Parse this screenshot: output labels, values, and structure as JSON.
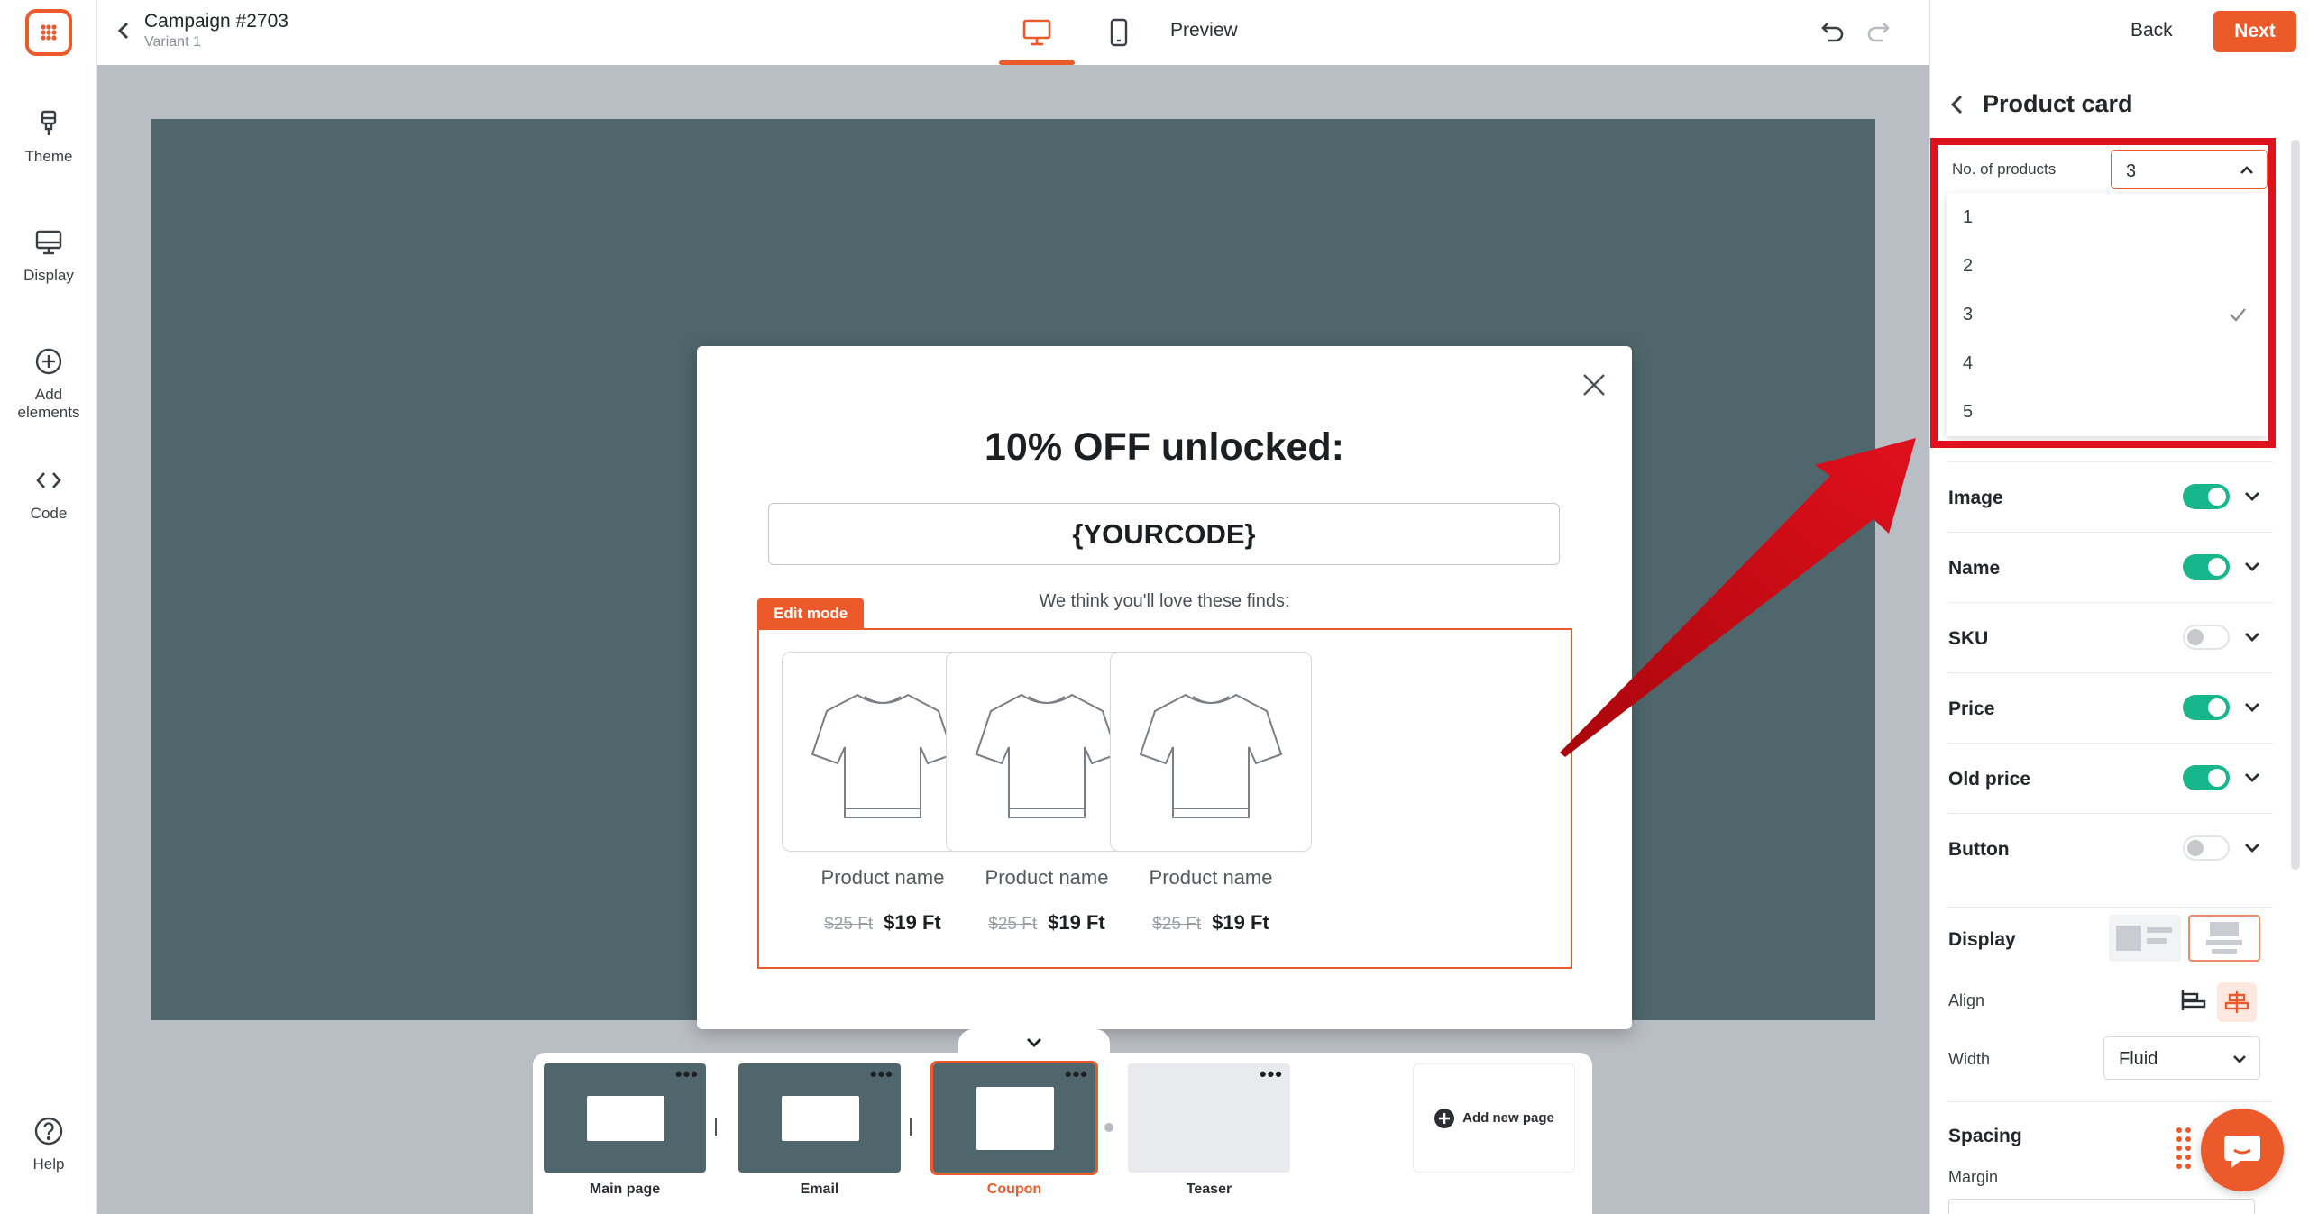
{
  "rail": {
    "items": [
      {
        "label": "Theme",
        "icon": "paintbrush-icon"
      },
      {
        "label": "Display",
        "icon": "monitor-icon"
      },
      {
        "label": "Add elements",
        "icon": "plus-circle-icon"
      },
      {
        "label": "Code",
        "icon": "code-icon"
      }
    ],
    "help_label": "Help"
  },
  "topbar": {
    "campaign_title": "Campaign #2703",
    "variant": "Variant 1",
    "preview_label": "Preview",
    "back_label": "Back",
    "next_label": "Next"
  },
  "popup": {
    "headline": "10% OFF unlocked:",
    "coupon_code": "{YOURCODE}",
    "subtitle": "We think you'll love these finds:",
    "edit_badge": "Edit mode",
    "products": [
      {
        "name": "Product name",
        "old_price": "$25 Ft",
        "price": "$19 Ft"
      },
      {
        "name": "Product name",
        "old_price": "$25 Ft",
        "price": "$19 Ft"
      },
      {
        "name": "Product name",
        "old_price": "$25 Ft",
        "price": "$19 Ft"
      }
    ]
  },
  "pages": [
    {
      "label": "Main page",
      "active": false
    },
    {
      "label": "Email",
      "active": false
    },
    {
      "label": "Coupon",
      "active": true
    },
    {
      "label": "Teaser",
      "active": false
    }
  ],
  "add_page_label": "Add new page",
  "panel": {
    "title": "Product card",
    "no_products_label": "No. of products",
    "no_products_value": "3",
    "options": [
      "1",
      "2",
      "3",
      "4",
      "5"
    ],
    "selected_option": "3",
    "toggles": [
      {
        "label": "Image",
        "on": true
      },
      {
        "label": "Name",
        "on": true
      },
      {
        "label": "SKU",
        "on": false
      },
      {
        "label": "Price",
        "on": true
      },
      {
        "label": "Old price",
        "on": true
      },
      {
        "label": "Button",
        "on": false
      }
    ],
    "display_label": "Display",
    "align_label": "Align",
    "width_label": "Width",
    "width_value": "Fluid",
    "spacing_label": "Spacing",
    "margin_label": "Margin"
  },
  "colors": {
    "accent": "#ec5a2b",
    "toggle_on": "#17b68c",
    "stage_bg": "#4f676c",
    "highlight": "#e0101d"
  }
}
